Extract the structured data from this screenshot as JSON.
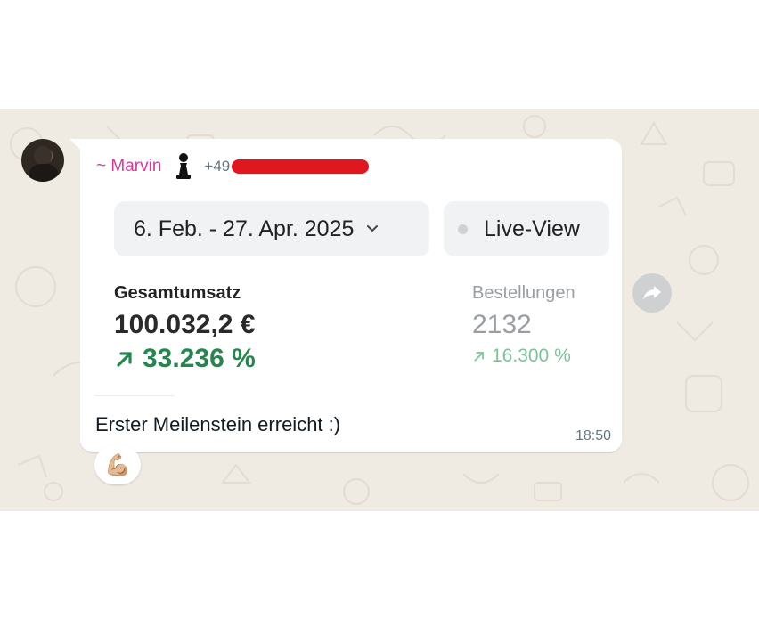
{
  "message": {
    "sender_name": "~ Marvin",
    "sender_badge_icon": "chess-pawn-icon",
    "phone_prefix": "+49",
    "time": "18:50",
    "caption": "Erster Meilenstein erreicht :)",
    "reaction": "💪🏼"
  },
  "dashboard": {
    "date_range": "6. Feb. - 27. Apr. 2025",
    "live_view_label": "Live-View",
    "metrics": [
      {
        "label": "Gesamtumsatz",
        "value": "100.032,2 €",
        "change": "33.236 %"
      },
      {
        "label": "Bestellungen",
        "value": "2132",
        "change": "16.300 %"
      }
    ]
  },
  "colors": {
    "chat_background": "#efeae2",
    "sender_name": "#d63b9b",
    "positive_change": "#27864f",
    "redaction": "#e0171e"
  }
}
